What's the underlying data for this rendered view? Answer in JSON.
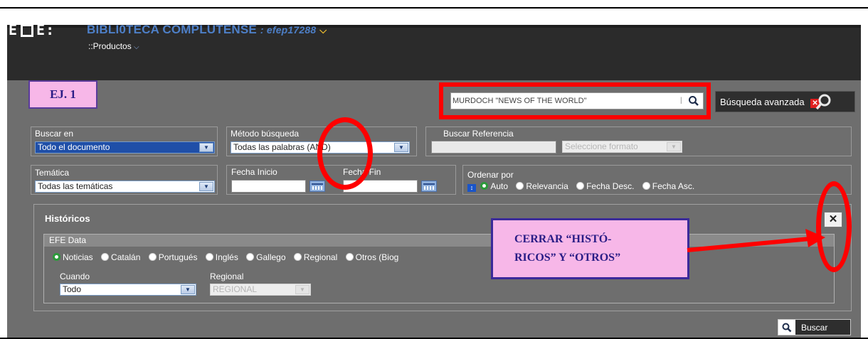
{
  "header": {
    "logo_text_left": "E",
    "logo_text_right": "E:",
    "title": "BIBLI0TECA COMPLUTENSE",
    "user": ": efep17288",
    "products_label": "::Productos"
  },
  "annotations": {
    "example_label": "EJ. 1",
    "note_line1": "CERRAR “HISTÓ-",
    "note_line2": "RICOS” Y “OTROS”"
  },
  "search": {
    "value": "MURDOCH \"NEWS OF THE WORLD\"",
    "advanced_label": "Búsqueda avanzada"
  },
  "filters": {
    "buscar_en": {
      "label": "Buscar en",
      "value": "Todo el documento"
    },
    "metodo": {
      "label": "Método búsqueda",
      "value": "Todas las palabras (AND)"
    },
    "referencia": {
      "label": "Buscar Referencia",
      "format_placeholder": "Seleccione formato"
    },
    "tematica": {
      "label": "Temática",
      "value": "Todas las temáticas"
    },
    "fecha_inicio": {
      "label": "Fecha Inicio"
    },
    "fecha_fin": {
      "label": "Fecha Fin"
    },
    "ordenar": {
      "label": "Ordenar por",
      "options": [
        "Auto",
        "Relevancia",
        "Fecha Desc.",
        "Fecha Asc."
      ],
      "selected": "Auto"
    }
  },
  "historicos": {
    "title": "Históricos",
    "efe_data_label": "EFE Data",
    "sources": [
      "Noticias",
      "Catalán",
      "Portugués",
      "Inglés",
      "Gallego",
      "Regional",
      "Otros (Biog"
    ],
    "selected_source": "Noticias",
    "cuando": {
      "label": "Cuando",
      "value": "Todo"
    },
    "regional": {
      "label": "Regional",
      "value": "REGIONAL"
    }
  },
  "actions": {
    "buscar_label": "Buscar"
  },
  "colors": {
    "title_blue": "#4d7fc7",
    "annotation_red": "#ff0000",
    "annotation_pink": "#f7b7e8"
  }
}
